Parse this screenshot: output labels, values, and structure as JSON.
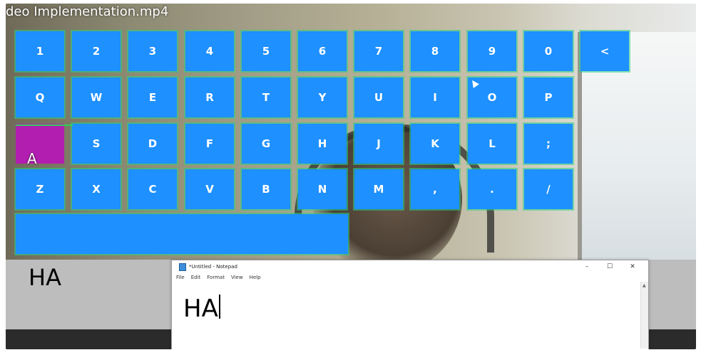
{
  "video": {
    "title": "deo Implementation.mp4"
  },
  "keyboard": {
    "rows": [
      [
        "1",
        "2",
        "3",
        "4",
        "5",
        "6",
        "7",
        "8",
        "9",
        "0",
        "<"
      ],
      [
        "Q",
        "W",
        "E",
        "R",
        "T",
        "Y",
        "U",
        "I",
        "O",
        "P"
      ],
      [
        "A",
        "S",
        "D",
        "F",
        "G",
        "H",
        "J",
        "K",
        "L",
        ";"
      ],
      [
        "Z",
        "X",
        "C",
        "V",
        "B",
        "N",
        "M",
        ",",
        ".",
        "/"
      ]
    ],
    "selected_key": "A",
    "space_label": ""
  },
  "overlay": {
    "typed_text": "HA",
    "hover_letter": "A"
  },
  "notepad": {
    "title": "*Untitled - Notepad",
    "menus": [
      "File",
      "Edit",
      "Format",
      "View",
      "Help"
    ],
    "controls": {
      "minimize": "–",
      "maximize": "☐",
      "close": "✕"
    },
    "content": "HA"
  },
  "colors": {
    "key_fill": "#1e90ff",
    "key_selected": "#b21eb0",
    "key_text": "#ffffff",
    "key_border": "#28d282"
  }
}
